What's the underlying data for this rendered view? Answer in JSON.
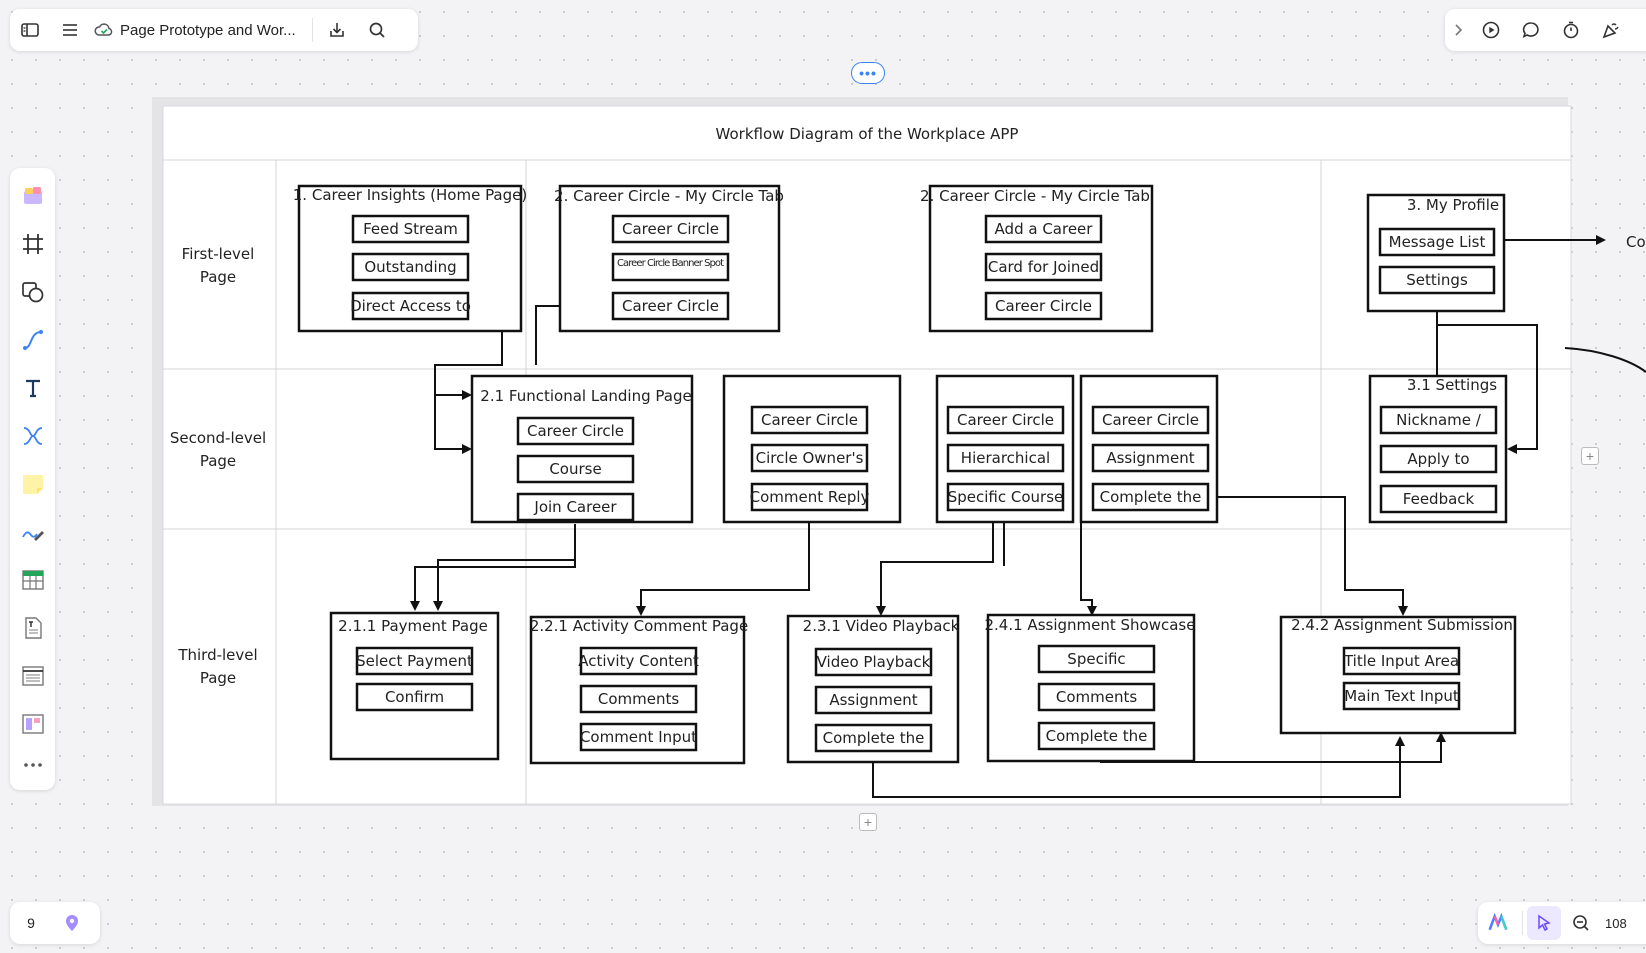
{
  "header": {
    "doc_title": "Page Prototype and Wor..."
  },
  "diagram": {
    "title": "Workflow Diagram of the Workplace APP",
    "rows": [
      "First-level\nPage",
      "Second-level\nPage",
      "Third-level\nPage"
    ],
    "offscreen_label": "Co",
    "nodes": {
      "n1": {
        "title": "1. Career Insights (Home Page)",
        "items": [
          "Feed Stream",
          "Outstanding",
          "Direct Access to"
        ]
      },
      "n2": {
        "title": "2. Career Circle - My Circle Tab",
        "items": [
          "Career Circle",
          "Career Circle Banner Spot",
          "Career Circle"
        ]
      },
      "n3": {
        "title": "2. Career Circle - My Circle Tab",
        "items": [
          "Add a Career",
          "Card for Joined",
          "Career Circle"
        ]
      },
      "n4": {
        "title": "3. My Profile",
        "items": [
          "Message List",
          "Settings"
        ]
      },
      "n5": {
        "title": "2.1 Functional Landing Page",
        "items": [
          "Career Circle",
          "Course",
          "Join Career"
        ]
      },
      "n6": {
        "title": "",
        "items": [
          "Career Circle",
          "Circle Owner's",
          "Comment Reply"
        ]
      },
      "n7": {
        "title": "",
        "items": [
          "Career Circle",
          "Hierarchical",
          "Specific Course"
        ]
      },
      "n8": {
        "title": "",
        "items": [
          "Career Circle",
          "Assignment",
          "Complete the"
        ]
      },
      "n9": {
        "title": "3.1 Settings",
        "items": [
          "Nickname /",
          "Apply to",
          "Feedback"
        ]
      },
      "n10": {
        "title": "2.1.1 Payment Page",
        "items": [
          "Select Payment",
          "Confirm"
        ]
      },
      "n11": {
        "title": "2.2.1 Activity Comment Page",
        "items": [
          "Activity Content",
          "Comments",
          "Comment Input"
        ]
      },
      "n12": {
        "title": "2.3.1 Video Playback",
        "items": [
          "Video Playback",
          "Assignment",
          "Complete the"
        ]
      },
      "n13": {
        "title": "2.4.1 Assignment Showcase",
        "items": [
          "Specific",
          "Comments",
          "Complete the"
        ]
      },
      "n14": {
        "title": "2.4.2 Assignment Submission",
        "items": [
          "Title Input Area",
          "Main Text Input"
        ]
      }
    }
  },
  "footer": {
    "page_count": "9",
    "zoom": "108"
  },
  "colors": {
    "accent": "#3b82f6",
    "canvas": "#f3f3f5",
    "line": "#111111"
  }
}
